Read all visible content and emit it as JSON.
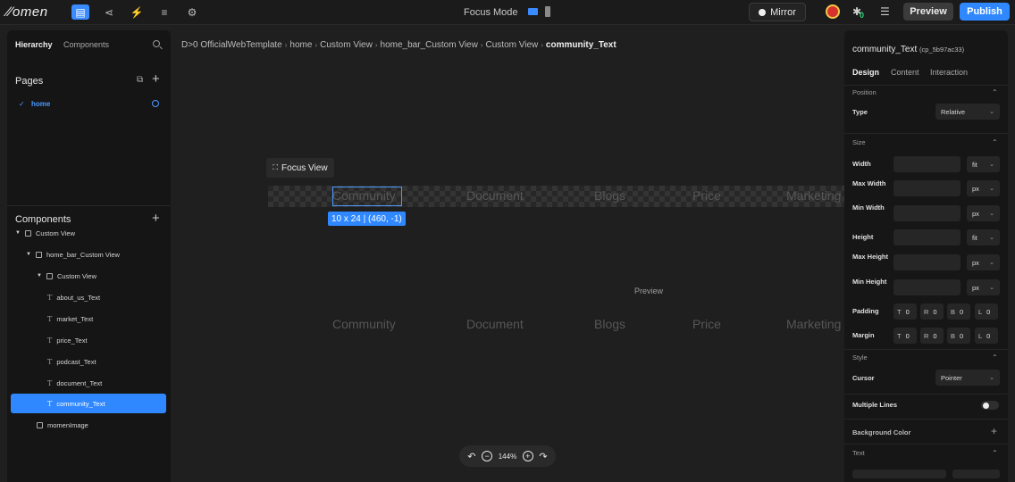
{
  "topbar": {
    "logo": "∕∕omen",
    "focus_mode_label": "Focus Mode",
    "mirror_label": "Mirror",
    "preview_label": "Preview",
    "publish_label": "Publish",
    "badge_value": "0",
    "accent_color": "#2f88ff"
  },
  "left_panel": {
    "tabs": [
      "Hierarchy",
      "Components"
    ],
    "pages_title": "Pages",
    "pages": [
      {
        "label": "home"
      }
    ],
    "components_title": "Components",
    "tree": [
      {
        "label": "Custom View",
        "type": "container",
        "expanded": true
      },
      {
        "label": "home_bar_Custom View",
        "type": "container",
        "expanded": true
      },
      {
        "label": "Custom View",
        "type": "container",
        "expanded": true
      },
      {
        "label": "about_us_Text",
        "type": "text"
      },
      {
        "label": "market_Text",
        "type": "text"
      },
      {
        "label": "price_Text",
        "type": "text"
      },
      {
        "label": "podcast_Text",
        "type": "text"
      },
      {
        "label": "document_Text",
        "type": "text"
      },
      {
        "label": "community_Text",
        "type": "text",
        "selected": true
      },
      {
        "label": "momenImage",
        "type": "image"
      }
    ]
  },
  "breadcrumb": {
    "items": [
      "OfficialWebTemplate",
      "home",
      "Custom View",
      "home_bar_Custom View",
      "Custom View",
      "community_Text"
    ]
  },
  "canvas": {
    "focus_view_label": "Focus View",
    "nav_items": [
      "Community",
      "Document",
      "Blogs",
      "Price",
      "Marketing"
    ],
    "dimension_tag": "10 x 24 | (460, -1)",
    "preview_label": "Preview",
    "preview_nav_items": [
      "Community",
      "Document",
      "Blogs",
      "Price",
      "Marketing"
    ],
    "zoom_level": "144%"
  },
  "right_panel": {
    "title": "community_Text",
    "title_id": "(cp_5b97ac33)",
    "tabs": [
      "Design",
      "Content",
      "Interaction"
    ],
    "position_section": "Position",
    "type_label": "Type",
    "type_value": "Relative",
    "size_section": "Size",
    "size_rows": [
      {
        "label": "Width",
        "unit": "fit"
      },
      {
        "label": "Max Width",
        "unit": "px"
      },
      {
        "label": "Min Width",
        "unit": "px"
      },
      {
        "label": "Height",
        "unit": "fit"
      },
      {
        "label": "Max Height",
        "unit": "px"
      },
      {
        "label": "Min Height",
        "unit": "px"
      }
    ],
    "padding_label": "Padding",
    "margin_label": "Margin",
    "padding": [
      {
        "side": "T",
        "value": "0"
      },
      {
        "side": "R",
        "value": "0"
      },
      {
        "side": "B",
        "value": "0"
      },
      {
        "side": "L",
        "value": "0"
      }
    ],
    "margin": [
      {
        "side": "T",
        "value": "0"
      },
      {
        "side": "R",
        "value": "0"
      },
      {
        "side": "B",
        "value": "0"
      },
      {
        "side": "L",
        "value": "0"
      }
    ],
    "style_section": "Style",
    "cursor_label": "Cursor",
    "cursor_value": "Pointer",
    "multiple_lines_label": "Multiple Lines",
    "multiple_lines_on": false,
    "background_color_label": "Background Color",
    "text_section": "Text"
  }
}
